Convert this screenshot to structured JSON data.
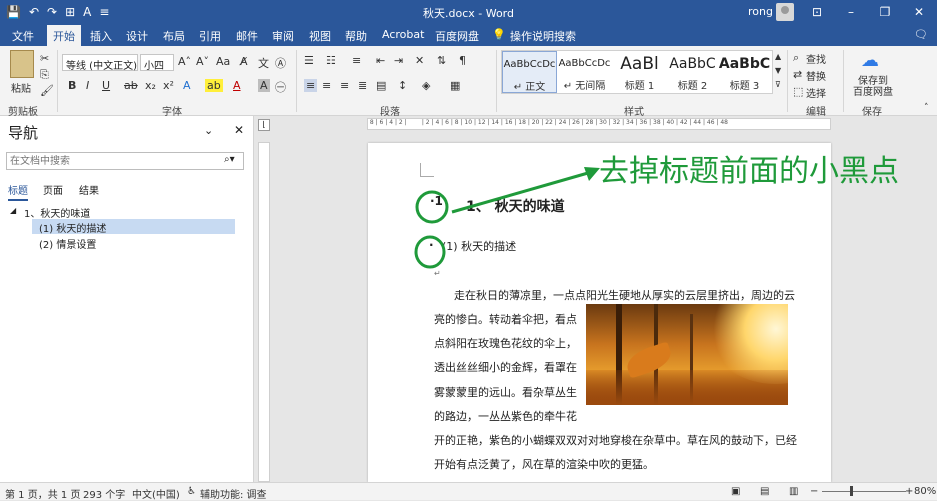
{
  "titlebar": {
    "title": "秋天.docx - Word",
    "user": "rong",
    "qat": [
      "💾",
      "↶",
      "↷",
      "⊞",
      "A",
      "≡"
    ]
  },
  "tabs": [
    "文件",
    "开始",
    "插入",
    "设计",
    "布局",
    "引用",
    "邮件",
    "审阅",
    "视图",
    "帮助",
    "Acrobat",
    "百度网盘",
    "操作说明搜索"
  ],
  "ribbon": {
    "clipboard": {
      "paste": "粘贴",
      "label": "剪贴板"
    },
    "font": {
      "name": "等线 (中文正文)",
      "size": "小四",
      "label": "字体",
      "bold": "B",
      "italic": "I",
      "underline": "U"
    },
    "paragraph": {
      "label": "段落"
    },
    "styles": {
      "label": "样式",
      "items": [
        {
          "preview": "AaBbCcDc",
          "name": "↵ 正文"
        },
        {
          "preview": "AaBbCcDc",
          "name": "↵ 无间隔"
        },
        {
          "preview": "AaBl",
          "name": "标题 1"
        },
        {
          "preview": "AaBbC",
          "name": "标题 2"
        },
        {
          "preview": "AaBbC",
          "name": "标题 3"
        }
      ]
    },
    "editing": {
      "label": "编辑",
      "find": "查找",
      "replace": "替换",
      "select": "选择"
    },
    "save": {
      "label": "保存",
      "button": "保存到\n百度网盘"
    }
  },
  "nav": {
    "title": "导航",
    "search_placeholder": "在文档中搜索",
    "tabs": [
      "标题",
      "页面",
      "结果"
    ],
    "tree": [
      "1、秋天的味道",
      "(1) 秋天的描述",
      "(2) 情景设置"
    ]
  },
  "doc": {
    "annotation": "去掉标题前面的小黑点",
    "heading1": "1、 秋天的味道",
    "heading2": "(1) 秋天的描述",
    "lines": [
      "走在秋日的薄凉里，一点点阳光生硬地从厚实的云层里挤出，周边的云",
      "亮的惨白。转动着伞把，看点",
      "点斜阳在玫瑰色花纹的伞上，",
      "透出丝丝细小的金辉，看罩在",
      "雾蒙蒙里的远山。看杂草丛生",
      "的路边，一丛丛紫色的牵牛花",
      "开的正艳，紫色的小蝴蝶双双对对地穿梭在杂草中。草在风的鼓动下，已经",
      "开始有点泛黄了，风在草的渲染中吹的更猛。"
    ]
  },
  "status": {
    "page": "第 1 页，共 1 页",
    "words": "293 个字",
    "lang": "中文(中国)",
    "access": "辅助功能: 调查",
    "zoom": "80%"
  },
  "colors": {
    "accent": "#2b579a",
    "annotation": "#1f9a3a"
  }
}
